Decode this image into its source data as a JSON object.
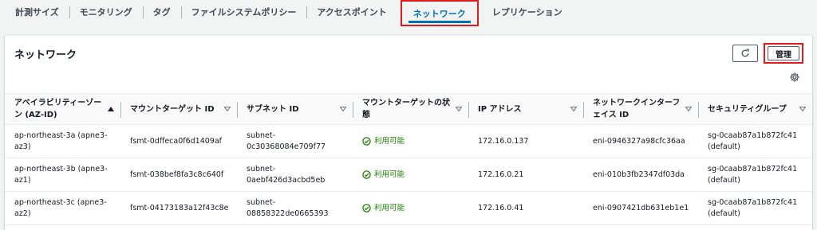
{
  "tabs": [
    {
      "label": "計測サイズ",
      "active": false
    },
    {
      "label": "モニタリング",
      "active": false
    },
    {
      "label": "タグ",
      "active": false
    },
    {
      "label": "ファイルシステムポリシー",
      "active": false
    },
    {
      "label": "アクセスポイント",
      "active": false
    },
    {
      "label": "ネットワーク",
      "active": true
    },
    {
      "label": "レプリケーション",
      "active": false
    }
  ],
  "panel": {
    "title": "ネットワーク",
    "manage_label": "管理",
    "refresh_icon": "refresh-icon",
    "settings_icon": "gear-icon"
  },
  "table": {
    "columns": [
      "アベイラビリティーゾーン (AZ-ID)",
      "マウントターゲット ID",
      "サブネット ID",
      "マウントターゲットの状態",
      "IP アドレス",
      "ネットワークインターフェイス ID",
      "セキュリティグループ"
    ],
    "rows": [
      {
        "az": "ap-northeast-3a (apne3-az3)",
        "mount_target": "fsmt-0dffeca0f6d1409af",
        "subnet": "subnet-0c30368084e709f77",
        "state": "利用可能",
        "ip": "172.16.0.137",
        "eni": "eni-0946327a98cfc36aa",
        "sg": "sg-0caab87a1b872fc41 (default)"
      },
      {
        "az": "ap-northeast-3b (apne3-az1)",
        "mount_target": "fsmt-038bef8fa3c8c640f",
        "subnet": "subnet-0aebf426d3acbd5eb",
        "state": "利用可能",
        "ip": "172.16.0.21",
        "eni": "eni-010b3fb2347df03da",
        "sg": "sg-0caab87a1b872fc41 (default)"
      },
      {
        "az": "ap-northeast-3c (apne3-az2)",
        "mount_target": "fsmt-04173183a12f43c8e",
        "subnet": "subnet-08858322de0665393",
        "state": "利用可能",
        "ip": "172.16.0.41",
        "eni": "eni-0907421db631eb1e1",
        "sg": "sg-0caab87a1b872fc41 (default)"
      }
    ]
  },
  "colors": {
    "accent": "#0073bb",
    "highlight": "#e01b1b",
    "success": "#1d8102"
  }
}
